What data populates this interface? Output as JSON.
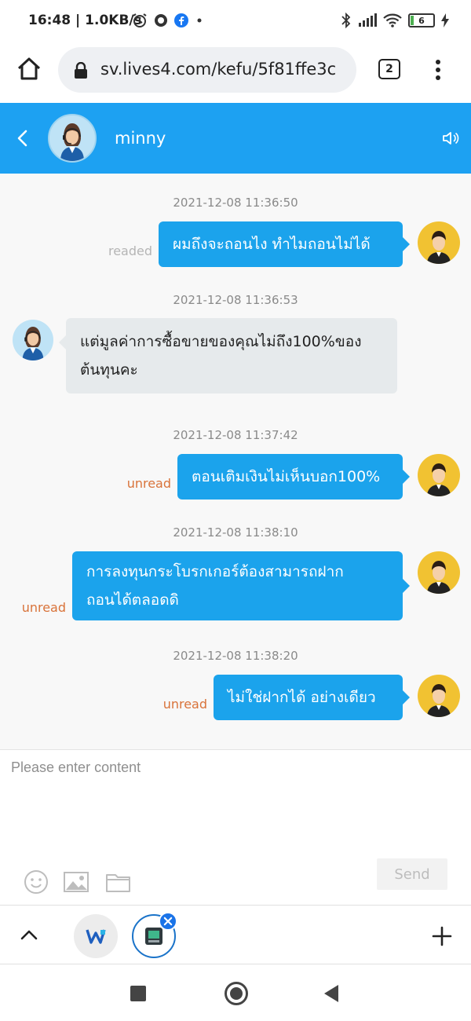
{
  "status_bar": {
    "time_speed": "16:48 | 1.0KB/s",
    "battery_level": "6",
    "icons": [
      "alarm-icon",
      "vpn-icon",
      "facebook-icon",
      "dot-icon",
      "bluetooth-icon",
      "signal-icon",
      "wifi-icon",
      "battery-icon",
      "charging-icon"
    ]
  },
  "browser": {
    "url": "sv.lives4.com/kefu/5f81ffe3c",
    "tab_count": "2"
  },
  "chat_header": {
    "agent_name": "minny"
  },
  "messages": [
    {
      "timestamp": "2021-12-08 11:36:50",
      "direction": "out",
      "text": "ผมถึงจะถอนไง ทำไมถอนไม่ได้",
      "state": "readed"
    },
    {
      "timestamp": "2021-12-08 11:36:53",
      "direction": "in",
      "lines": [
        "แต่มูลค่าการซื้อขายของคุณไม่ถึง100%ของ",
        "ต้นทุนคะ"
      ]
    },
    {
      "timestamp": "2021-12-08 11:37:42",
      "direction": "out",
      "text": "ตอนเติมเงินไม่เห็นบอก100%",
      "state": "unread"
    },
    {
      "timestamp": "2021-12-08 11:38:10",
      "direction": "out",
      "lines": [
        "การลงทุนกระโบรกเกอร์ต้องสามารถฝาก",
        "ถอนได้ตลอดดิ"
      ],
      "state": "unread"
    },
    {
      "timestamp": "2021-12-08 11:38:20",
      "direction": "out",
      "text": "ไม่ใช่ฝากได้ อย่างเดียว",
      "state": "unread"
    }
  ],
  "input": {
    "placeholder": "Please enter content",
    "send_label": "Send"
  },
  "colors": {
    "header_blue": "#1da1f2",
    "bubble_out": "#1ba3ec",
    "bubble_in": "#e6eaec",
    "unread": "#d9733a",
    "readed": "#b5b5b5"
  }
}
